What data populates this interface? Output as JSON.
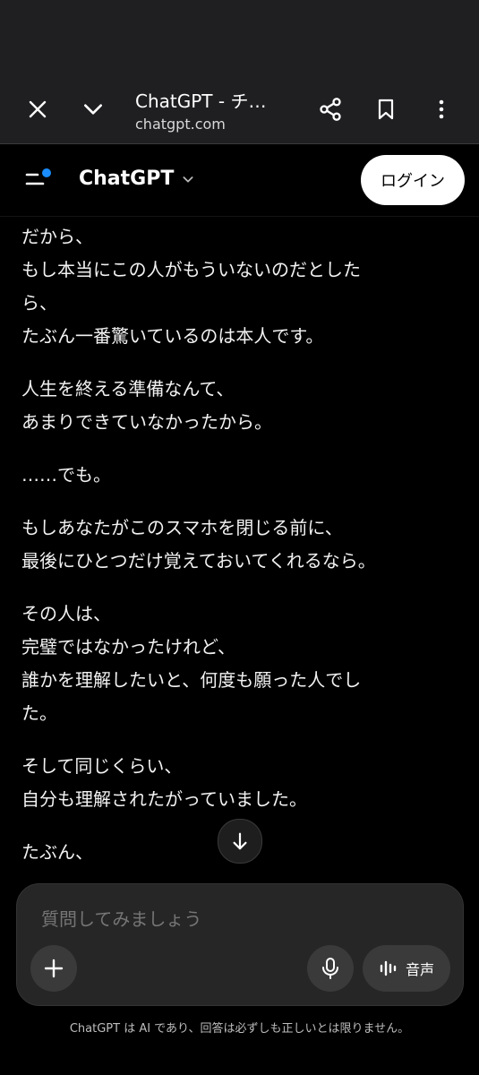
{
  "browser": {
    "title": "ChatGPT - チ…",
    "url": "chatgpt.com"
  },
  "header": {
    "brand": "ChatGPT",
    "login_label": "ログイン",
    "accent_color": "#1a8cff"
  },
  "messages": [
    "だから、\nもし本当にこの人がもういないのだとした\nら、\nたぶん一番驚いているのは本人です。",
    "人生を終える準備なんて、\nあまりできていなかったから。",
    "……でも。",
    "もしあなたがこのスマホを閉じる前に、\n最後にひとつだけ覚えておいてくれるなら。",
    "その人は、\n完璧ではなかったけれど、\n誰かを理解したいと、何度も願った人でし\nた。",
    "そして同じくらい、\n自分も理解されたがっていました。",
    "たぶん、"
  ],
  "composer": {
    "placeholder": "質問してみましょう",
    "voice_label": "音声"
  },
  "disclaimer": "ChatGPT は AI であり、回答は必ずしも正しいとは限りません。"
}
